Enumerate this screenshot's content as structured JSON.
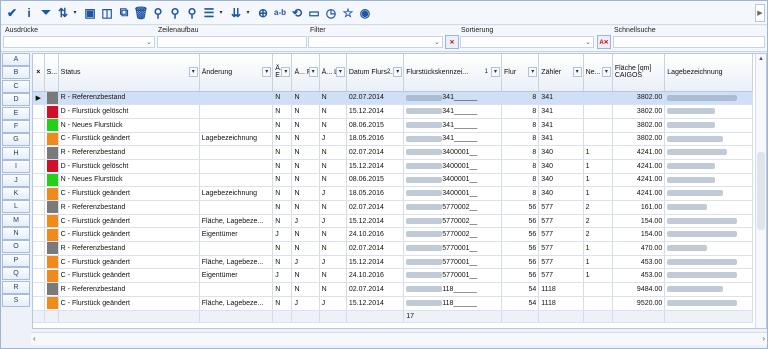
{
  "toolbar": {
    "items": [
      {
        "name": "check-icon",
        "glyph": "✔",
        "dd": false
      },
      {
        "name": "info-icon",
        "glyph": "i",
        "dd": false
      },
      {
        "name": "filter-icon",
        "glyph": "⏷",
        "dd": false
      },
      {
        "name": "sort-az-icon",
        "glyph": "⇅",
        "dd": true
      },
      {
        "name": "find-icon",
        "glyph": "▣",
        "dd": false
      },
      {
        "name": "binoculars-icon",
        "glyph": "◫",
        "dd": false
      },
      {
        "name": "copy-icon",
        "glyph": "⧉",
        "dd": false
      },
      {
        "name": "delete-icon",
        "glyph": "🗑",
        "dd": false
      },
      {
        "name": "tree-icon",
        "glyph": "⚲",
        "dd": false
      },
      {
        "name": "tree2-icon",
        "glyph": "⚲",
        "dd": false
      },
      {
        "name": "tree3-icon",
        "glyph": "⚲",
        "dd": false
      },
      {
        "name": "records-icon",
        "glyph": "☰",
        "dd": true
      },
      {
        "name": "export-icon",
        "glyph": "⇊",
        "dd": true
      },
      {
        "name": "target-icon",
        "glyph": "⊕",
        "dd": false
      },
      {
        "name": "rename-icon",
        "glyph": "a-b",
        "dd": false
      },
      {
        "name": "refresh-icon",
        "glyph": "⟲",
        "dd": false
      },
      {
        "name": "table-icon",
        "glyph": "▭",
        "dd": false
      },
      {
        "name": "timer-icon",
        "glyph": "◷",
        "dd": false
      },
      {
        "name": "star-icon",
        "glyph": "☆",
        "dd": false
      },
      {
        "name": "eye-icon",
        "glyph": "◉",
        "dd": false
      }
    ]
  },
  "filters": {
    "ausdruecke": "Ausdrücke",
    "zeilenaufbau": "Zeilenaufbau",
    "filter": "Filter",
    "sortierung": "Sortierung",
    "schnellsuche": "Schnellsuche"
  },
  "alphabet": [
    "A",
    "B",
    "C",
    "D",
    "E",
    "F",
    "G",
    "H",
    "I",
    "J",
    "K",
    "L",
    "M",
    "N",
    "O",
    "P",
    "Q",
    "R",
    "S"
  ],
  "columns": [
    {
      "key": "x",
      "label": "×",
      "fb": false
    },
    {
      "key": "s",
      "label": "S...",
      "fb": false
    },
    {
      "key": "status",
      "label": "Status",
      "fb": true
    },
    {
      "key": "aenderung",
      "label": "Änderung",
      "fb": true
    },
    {
      "key": "ae",
      "label": "Ä... E...",
      "fb": true
    },
    {
      "key": "af",
      "label": "Ä... F...",
      "fb": true
    },
    {
      "key": "al",
      "label": "Ä... L...",
      "fb": true
    },
    {
      "key": "datum",
      "label": "Datum Flurs...",
      "fb": true,
      "badge": "2"
    },
    {
      "key": "kennz",
      "label": "Flurstückskennzei...",
      "fb": true,
      "badge": "1"
    },
    {
      "key": "flur",
      "label": "Flur",
      "fb": true
    },
    {
      "key": "zaehler",
      "label": "Zähler",
      "fb": true
    },
    {
      "key": "ne",
      "label": "Ne...",
      "fb": true
    },
    {
      "key": "flaeche",
      "label": "Fläche [qm] CAIGOS",
      "fb": false
    },
    {
      "key": "lage",
      "label": "Lagebezeichnung",
      "fb": false
    }
  ],
  "colors": {
    "R": "#7a7a7a",
    "D": "#d0102b",
    "N": "#22d019",
    "C": "#f08a1a"
  },
  "rows": [
    {
      "code": "R",
      "status": "R - Referenzbestand",
      "aenderung": "",
      "ae": "N",
      "af": "N",
      "al": "N",
      "datum": "02.07.2014",
      "kz": "341______",
      "flur": "8",
      "zaehler": "341",
      "ne": "",
      "flaeche": "3802.00",
      "lage": 70,
      "sel": true
    },
    {
      "code": "D",
      "status": "D - Flurstück gelöscht",
      "aenderung": "",
      "ae": "N",
      "af": "N",
      "al": "N",
      "datum": "15.12.2014",
      "kz": "341______",
      "flur": "8",
      "zaehler": "341",
      "ne": "",
      "flaeche": "3802.00",
      "lage": 48
    },
    {
      "code": "N",
      "status": "N - Neues Flurstück",
      "aenderung": "",
      "ae": "N",
      "af": "N",
      "al": "N",
      "datum": "08.06.2015",
      "kz": "341______",
      "flur": "8",
      "zaehler": "341",
      "ne": "",
      "flaeche": "3802.00",
      "lage": 48
    },
    {
      "code": "C",
      "status": "C - Flurstück geändert",
      "aenderung": "Lagebezeichnung",
      "ae": "N",
      "af": "N",
      "al": "J",
      "datum": "18.05.2016",
      "kz": "341______",
      "flur": "8",
      "zaehler": "341",
      "ne": "",
      "flaeche": "3802.00",
      "lage": 56
    },
    {
      "code": "R",
      "status": "R - Referenzbestand",
      "aenderung": "",
      "ae": "N",
      "af": "N",
      "al": "N",
      "datum": "02.07.2014",
      "kz": "3400001__",
      "flur": "8",
      "zaehler": "340",
      "ne": "1",
      "flaeche": "4241.00",
      "lage": 60
    },
    {
      "code": "D",
      "status": "D - Flurstück gelöscht",
      "aenderung": "",
      "ae": "N",
      "af": "N",
      "al": "N",
      "datum": "15.12.2014",
      "kz": "3400001__",
      "flur": "8",
      "zaehler": "340",
      "ne": "1",
      "flaeche": "4241.00",
      "lage": 48
    },
    {
      "code": "N",
      "status": "N - Neues Flurstück",
      "aenderung": "",
      "ae": "N",
      "af": "N",
      "al": "N",
      "datum": "08.06.2015",
      "kz": "3400001__",
      "flur": "8",
      "zaehler": "340",
      "ne": "1",
      "flaeche": "4241.00",
      "lage": 48
    },
    {
      "code": "C",
      "status": "C - Flurstück geändert",
      "aenderung": "Lagebezeichnung",
      "ae": "N",
      "af": "N",
      "al": "J",
      "datum": "18.05.2016",
      "kz": "3400001__",
      "flur": "8",
      "zaehler": "340",
      "ne": "1",
      "flaeche": "4241.00",
      "lage": 56
    },
    {
      "code": "R",
      "status": "R - Referenzbestand",
      "aenderung": "",
      "ae": "N",
      "af": "N",
      "al": "N",
      "datum": "02.07.2014",
      "kz": "5770002__",
      "flur": "56",
      "zaehler": "577",
      "ne": "2",
      "flaeche": "161.00",
      "lage": 40
    },
    {
      "code": "C",
      "status": "C - Flurstück geändert",
      "aenderung": "Fläche, Lagebeze...",
      "ae": "N",
      "af": "J",
      "al": "J",
      "datum": "15.12.2014",
      "kz": "5770002__",
      "flur": "56",
      "zaehler": "577",
      "ne": "2",
      "flaeche": "154.00",
      "lage": 70
    },
    {
      "code": "C",
      "status": "C - Flurstück geändert",
      "aenderung": "Eigentümer",
      "ae": "J",
      "af": "N",
      "al": "N",
      "datum": "24.10.2016",
      "kz": "5770002__",
      "flur": "56",
      "zaehler": "577",
      "ne": "2",
      "flaeche": "154.00",
      "lage": 70
    },
    {
      "code": "R",
      "status": "R - Referenzbestand",
      "aenderung": "",
      "ae": "N",
      "af": "N",
      "al": "N",
      "datum": "02.07.2014",
      "kz": "5770001__",
      "flur": "56",
      "zaehler": "577",
      "ne": "1",
      "flaeche": "470.00",
      "lage": 40
    },
    {
      "code": "C",
      "status": "C - Flurstück geändert",
      "aenderung": "Fläche, Lagebeze...",
      "ae": "N",
      "af": "J",
      "al": "J",
      "datum": "15.12.2014",
      "kz": "5770001__",
      "flur": "56",
      "zaehler": "577",
      "ne": "1",
      "flaeche": "453.00",
      "lage": 70
    },
    {
      "code": "C",
      "status": "C - Flurstück geändert",
      "aenderung": "Eigentümer",
      "ae": "J",
      "af": "N",
      "al": "N",
      "datum": "24.10.2016",
      "kz": "5770001__",
      "flur": "56",
      "zaehler": "577",
      "ne": "1",
      "flaeche": "453.00",
      "lage": 70
    },
    {
      "code": "R",
      "status": "R - Referenzbestand",
      "aenderung": "",
      "ae": "N",
      "af": "N",
      "al": "N",
      "datum": "02.07.2014",
      "kz": "118______",
      "flur": "54",
      "zaehler": "1118",
      "ne": "",
      "flaeche": "9484.00",
      "lage": 56
    },
    {
      "code": "C",
      "status": "C - Flurstück geändert",
      "aenderung": "Fläche, Lagebeze...",
      "ae": "N",
      "af": "J",
      "al": "J",
      "datum": "15.12.2014",
      "kz": "118______",
      "flur": "54",
      "zaehler": "1118",
      "ne": "",
      "flaeche": "9520.00",
      "lage": 70
    }
  ],
  "footer": {
    "count": "17"
  }
}
